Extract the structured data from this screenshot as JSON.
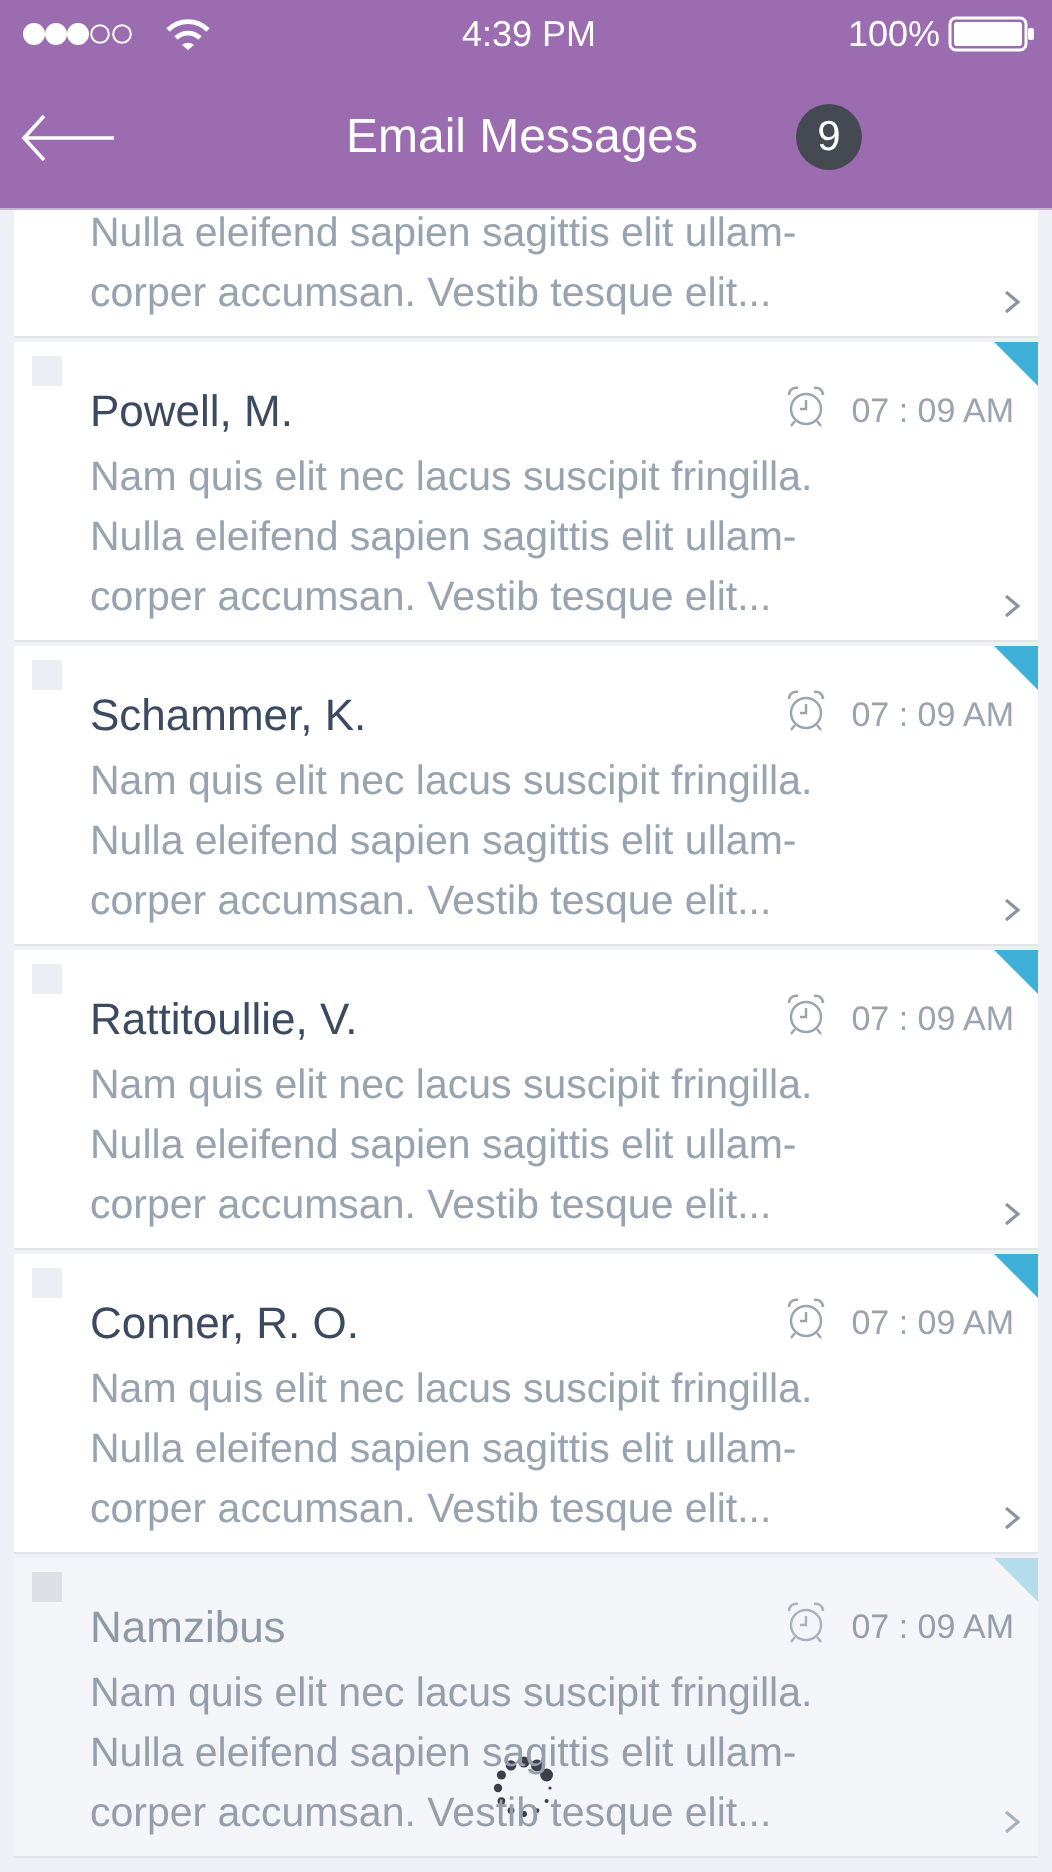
{
  "status_bar": {
    "time": "4:39 PM",
    "battery": "100%"
  },
  "header": {
    "title": "Email Messages",
    "badge": "9"
  },
  "messages": [
    {
      "kind": "partial",
      "preview_lines": [
        "Nulla eleifend sapien sagittis elit ullam-",
        "corper accumsan. Vestib tesque elit..."
      ]
    },
    {
      "kind": "full",
      "sender": "Powell, M.",
      "time": "07 : 09 AM",
      "checked": false,
      "flagged": true,
      "dimmed": false,
      "preview_lines": [
        "Nam quis elit nec lacus suscipit fringilla.",
        "Nulla eleifend sapien sagittis elit ullam-",
        "corper accumsan. Vestib tesque elit..."
      ]
    },
    {
      "kind": "full",
      "sender": "Schammer, K.",
      "time": "07 : 09 AM",
      "checked": false,
      "flagged": true,
      "dimmed": false,
      "preview_lines": [
        "Nam quis elit nec lacus suscipit fringilla.",
        "Nulla eleifend sapien sagittis elit ullam-",
        "corper accumsan. Vestib tesque elit..."
      ]
    },
    {
      "kind": "full",
      "sender": "Rattitoullie, V.",
      "time": "07 : 09 AM",
      "checked": false,
      "flagged": true,
      "dimmed": false,
      "preview_lines": [
        "Nam quis elit nec lacus suscipit fringilla.",
        "Nulla eleifend sapien sagittis elit ullam-",
        "corper accumsan. Vestib tesque elit..."
      ]
    },
    {
      "kind": "full",
      "sender": "Conner, R. O.",
      "time": "07 : 09 AM",
      "checked": false,
      "flagged": true,
      "dimmed": false,
      "preview_lines": [
        "Nam quis elit nec lacus suscipit fringilla.",
        "Nulla eleifend sapien sagittis elit ullam-",
        "corper accumsan. Vestib tesque elit..."
      ]
    },
    {
      "kind": "full",
      "sender": "Namzibus",
      "time": "07 : 09 AM",
      "checked": false,
      "flagged": true,
      "dimmed": true,
      "preview_lines": [
        "Nam quis elit nec lacus suscipit fringilla.",
        "Nulla eleifend sapien sagittis elit ullam-",
        "corper accumsan. Vestib tesque elit..."
      ]
    }
  ],
  "loading": true
}
